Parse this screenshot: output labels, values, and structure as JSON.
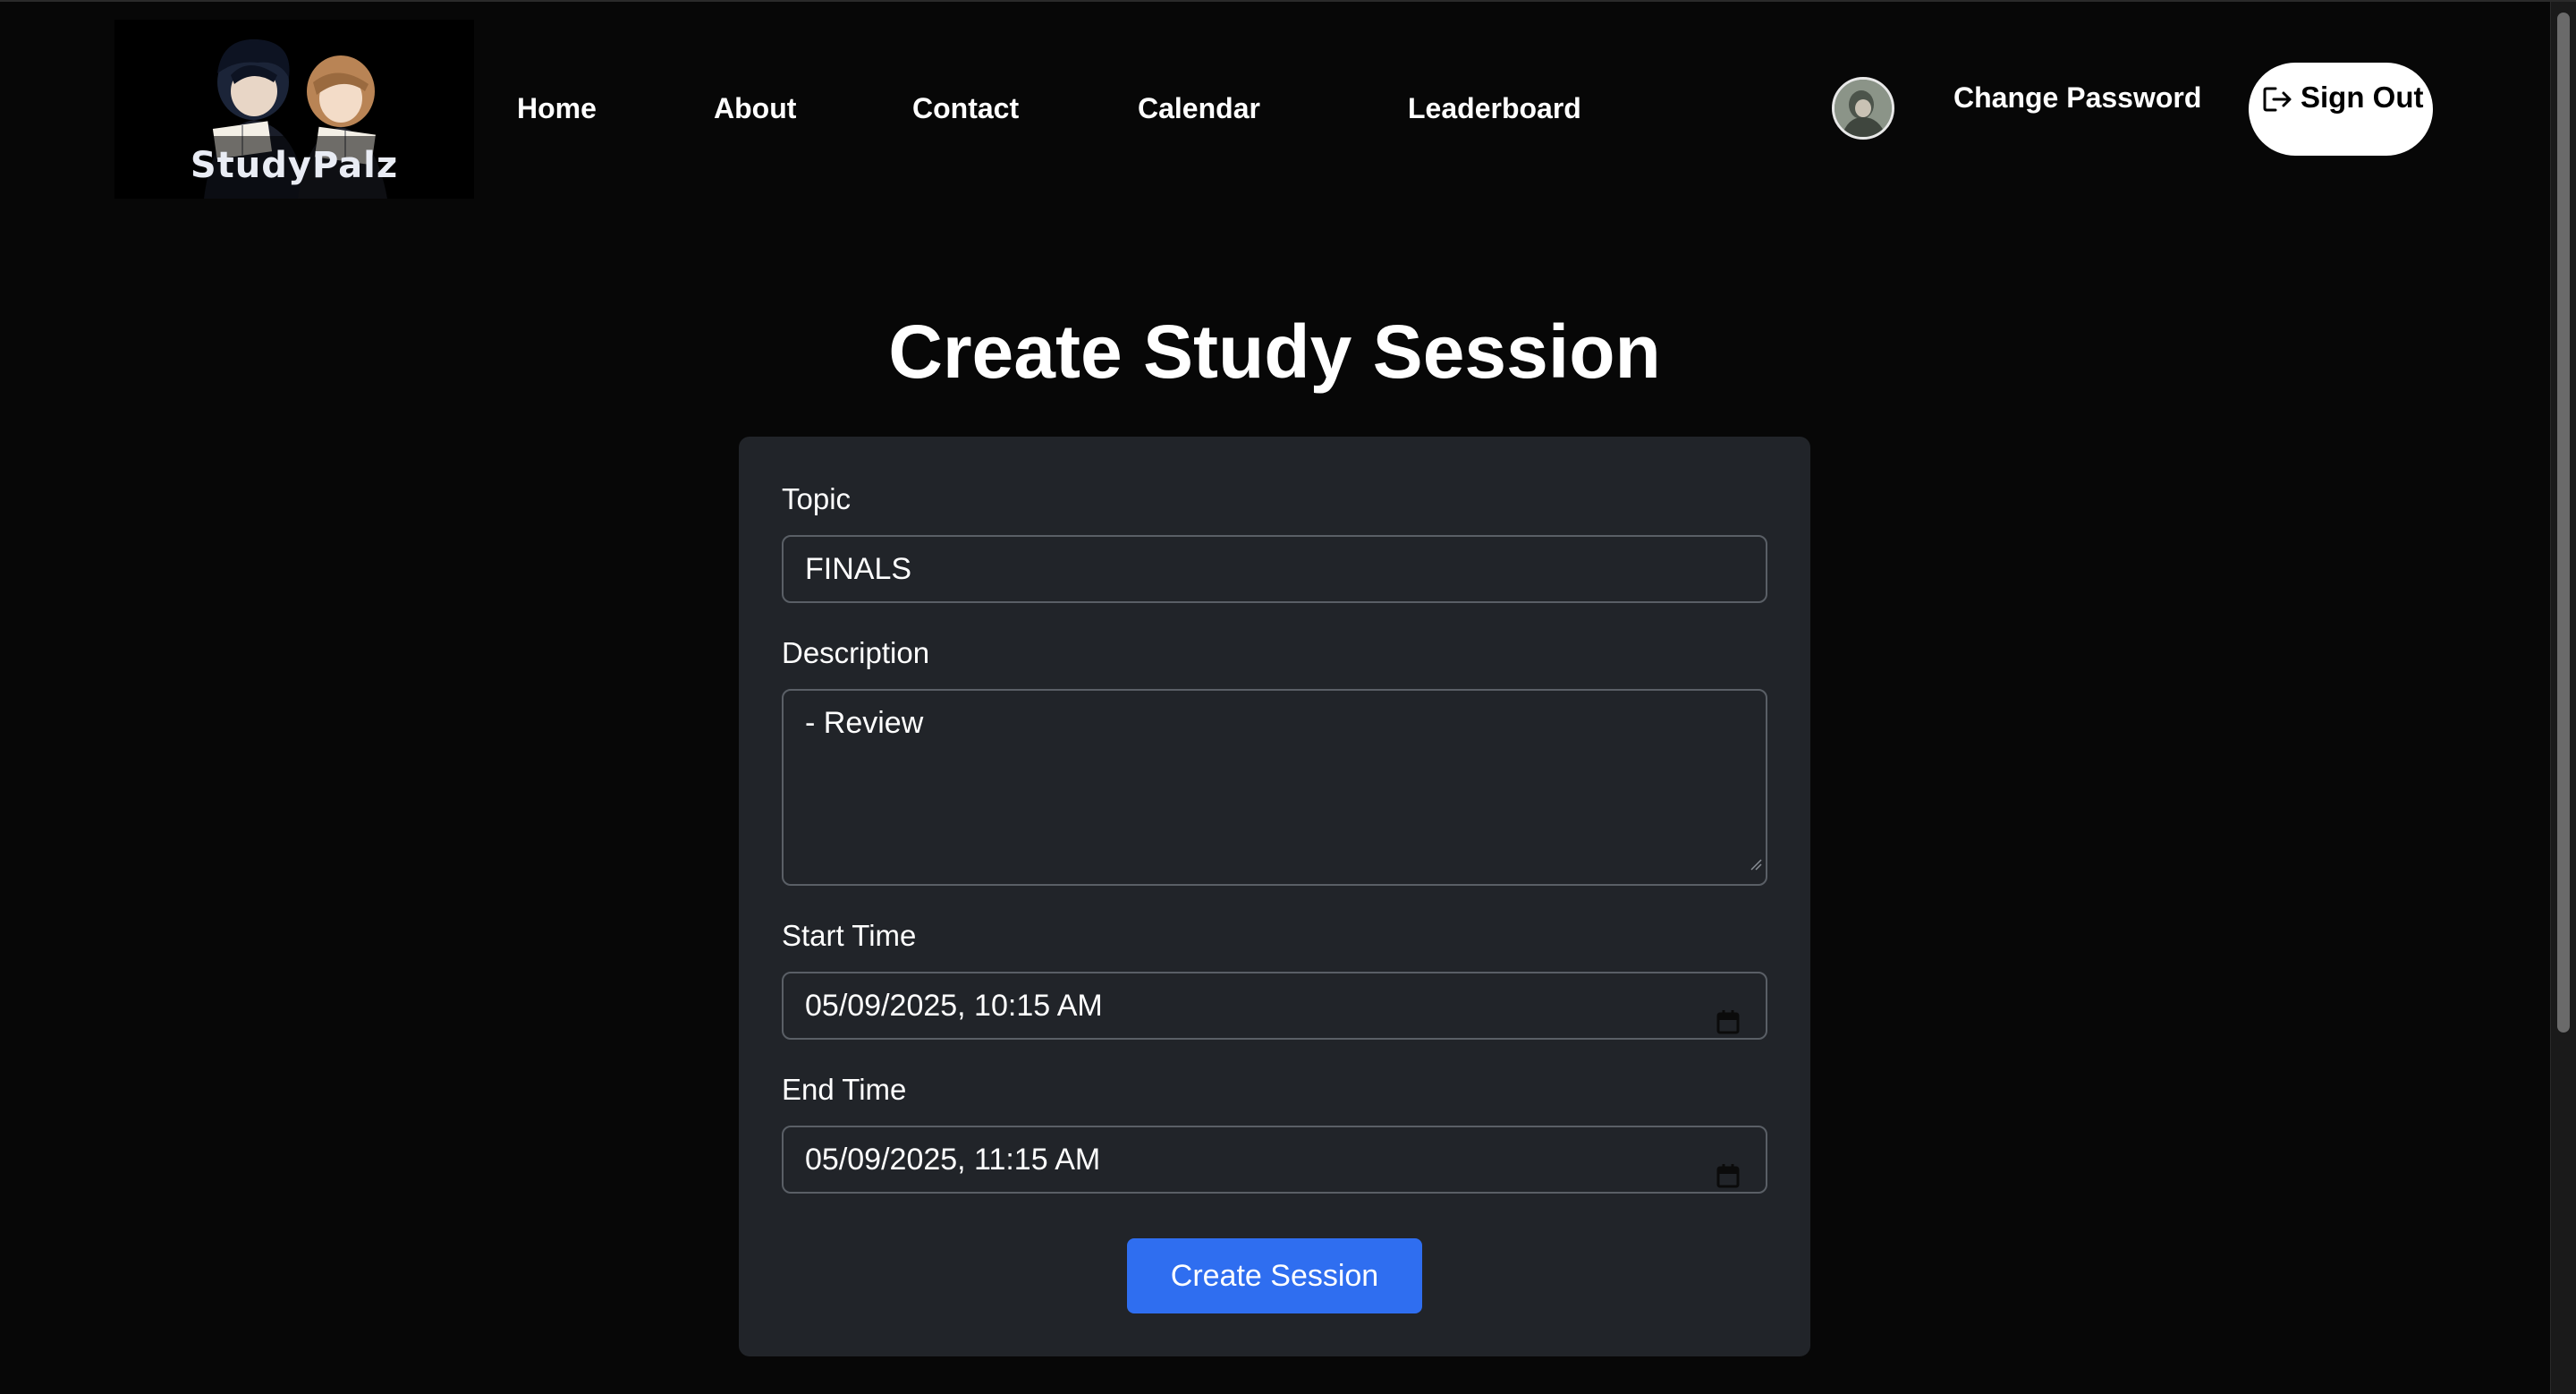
{
  "brand": {
    "name": "StudyPalz"
  },
  "nav": {
    "links": [
      {
        "label": "Home"
      },
      {
        "label": "About"
      },
      {
        "label": "Contact"
      },
      {
        "label": "Calendar"
      },
      {
        "label": "Leaderboard"
      }
    ],
    "change_password_label": "Change Password",
    "sign_out_label": "Sign Out"
  },
  "page": {
    "title": "Create Study Session"
  },
  "form": {
    "topic": {
      "label": "Topic",
      "value": "FINALS"
    },
    "description": {
      "label": "Description",
      "value": "- Review"
    },
    "start_time": {
      "label": "Start Time",
      "value": "05/09/2025, 10:15  AM"
    },
    "end_time": {
      "label": "End Time",
      "value": "05/09/2025, 11:15  AM"
    },
    "submit_label": "Create Session"
  },
  "icons": {
    "sign_out": "sign-out-icon",
    "calendar": "calendar-icon",
    "avatar": "avatar"
  },
  "colors": {
    "background": "#070707",
    "card": "#212429",
    "accent": "#2f6ef0",
    "sign_out_bg": "#ffffff"
  }
}
